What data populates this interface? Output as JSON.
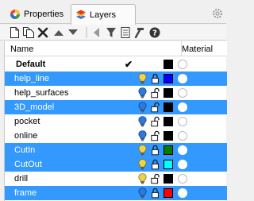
{
  "tabs": [
    {
      "label": "Properties",
      "icon": "properties-icon"
    },
    {
      "label": "Layers",
      "icon": "layers-icon",
      "active": true
    }
  ],
  "toolbar": {
    "buttons": [
      "new-layer-icon",
      "new-sublayer-icon",
      "delete-icon",
      "move-up-icon",
      "move-down-icon",
      "move-out-icon",
      "filter-icon",
      "layer-states-icon",
      "tools-icon",
      "help-icon"
    ]
  },
  "columns": {
    "name": "Name",
    "material": "Material"
  },
  "colors": {
    "selection": "#3399ff",
    "bulb_on": "#f1d34a",
    "bulb_off": "#ffffff"
  },
  "layers": [
    {
      "name": "Default",
      "current": true,
      "check": "✔",
      "color": "#000000",
      "selected": false,
      "bulb": "none"
    },
    {
      "name": "help_line",
      "color": "#0000ff",
      "selected": true,
      "bulb": "yellow",
      "locked": true
    },
    {
      "name": "help_surfaces",
      "color": "#000000",
      "selected": false,
      "bulb": "blue",
      "locked": false
    },
    {
      "name": "3D_model",
      "color": "#000000",
      "selected": true,
      "bulb": "blue",
      "locked": false
    },
    {
      "name": "pocket",
      "color": "#000000",
      "selected": false,
      "bulb": "blue",
      "locked": false
    },
    {
      "name": "online",
      "color": "#000000",
      "selected": false,
      "bulb": "blue",
      "locked": false
    },
    {
      "name": "CutIn",
      "color": "#008000",
      "selected": true,
      "bulb": "yellow",
      "locked": true
    },
    {
      "name": "CutOut",
      "color": "#00ffff",
      "selected": true,
      "bulb": "yellow",
      "locked": true
    },
    {
      "name": "drill",
      "color": "#000000",
      "selected": false,
      "bulb": "yellow",
      "locked": false
    },
    {
      "name": "frame",
      "color": "#ff0000",
      "selected": true,
      "bulb": "blue",
      "locked": true
    }
  ]
}
